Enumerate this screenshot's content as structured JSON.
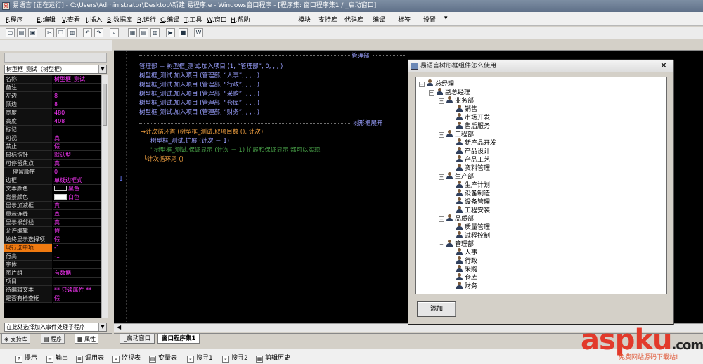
{
  "window": {
    "title": "易语言 [正在运行] - C:\\Users\\Administrator\\Desktop\\新建 易程序.e - Windows窗口程序 - [程序集: 窗口程序集1 / _启动窗口]"
  },
  "menu": {
    "items": [
      {
        "key": "F",
        "label": "程序"
      },
      {
        "key": "E",
        "label": "编辑"
      },
      {
        "key": "V",
        "label": "查看"
      },
      {
        "key": "I",
        "label": "插入"
      },
      {
        "key": "B",
        "label": "数据库"
      },
      {
        "key": "R",
        "label": "运行"
      },
      {
        "key": "C",
        "label": "编译"
      },
      {
        "key": "T",
        "label": "工具"
      },
      {
        "key": "W",
        "label": "窗口"
      },
      {
        "key": "H",
        "label": "帮助"
      }
    ],
    "right_items": [
      "模块",
      "支持库",
      "代码库",
      "编译",
      "标签",
      "设置"
    ]
  },
  "left_panel": {
    "combo_value": "树型框_测试（树型框）",
    "properties": [
      {
        "name": "名称",
        "value": "树型框_测试"
      },
      {
        "name": "备注",
        "value": ""
      },
      {
        "name": "左边",
        "value": "8"
      },
      {
        "name": "顶边",
        "value": "8"
      },
      {
        "name": "宽度",
        "value": "480"
      },
      {
        "name": "高度",
        "value": "408"
      },
      {
        "name": "标记",
        "value": ""
      },
      {
        "name": "可视",
        "value": "真"
      },
      {
        "name": "禁止",
        "value": "假"
      },
      {
        "name": "鼠标指针",
        "value": "默认型"
      },
      {
        "name": "可停留焦点",
        "value": "真"
      },
      {
        "name": "停留顺序",
        "value": "0"
      },
      {
        "name": "边框",
        "value": "单线边框式"
      },
      {
        "name": "文本颜色",
        "value": "黑色"
      },
      {
        "name": "背景颜色",
        "value": "白色"
      },
      {
        "name": "显示加减框",
        "value": "真"
      },
      {
        "name": "显示连线",
        "value": "真"
      },
      {
        "name": "显示根部线",
        "value": "真"
      },
      {
        "name": "允许编辑",
        "value": "假"
      },
      {
        "name": "始终显示选择项",
        "value": "假"
      },
      {
        "name": "现行选中项",
        "value": "-1"
      },
      {
        "name": "行高",
        "value": "-1"
      },
      {
        "name": "字体",
        "value": ""
      },
      {
        "name": "图片组",
        "value": "有数据"
      },
      {
        "name": "项目",
        "value": ""
      },
      {
        "name": "待编辑文本",
        "value": "** 只读属性 **"
      },
      {
        "name": "是否有检查框",
        "value": "假"
      }
    ],
    "event_combo": "在此处选择加入事件处理子程序",
    "tabs": [
      "支持库",
      "程序",
      "属性"
    ]
  },
  "code": {
    "header_label": "管理部",
    "lines": [
      "管理部 ＝ 树型框_测试.加入项目 (1, “管理部”, 0, , , )",
      "树型框_测试.加入项目 (管理部, “人事”, , , , )",
      "树型框_测试.加入项目 (管理部, “行政”, , , , )",
      "树型框_测试.加入项目 (管理部, “采购”, , , , )",
      "树型框_测试.加入项目 (管理部, “仓库”, , , , )",
      "树型框_测试.加入项目 (管理部, “财务”, , , , )"
    ],
    "section2_label": "树形框展开",
    "loop_head": "计次循环首 (树型框_测试.取项目数 (), 计次)",
    "loop_body": "树型框_测试.扩展 (计次 － 1)",
    "loop_comment": "' 树型框_测试.保证显示 (计次 － 1)   扩展和保证显示 都可以实现",
    "loop_tail": "计次循环尾 ()"
  },
  "editor_tabs": [
    "_启动窗口",
    "窗口程序集1"
  ],
  "bottom_bar": [
    "提示",
    "输出",
    "调用表",
    "监视表",
    "变量表",
    "搜寻1",
    "搜寻2",
    "剪辑历史"
  ],
  "dialog": {
    "title": "易语言树形框组件怎么使用",
    "close": "✕",
    "button": "添加",
    "tree": [
      {
        "level": 0,
        "label": "总经理",
        "expander": "−"
      },
      {
        "level": 1,
        "label": "副总经理",
        "expander": "−"
      },
      {
        "level": 2,
        "label": "业务部",
        "expander": "−"
      },
      {
        "level": 3,
        "label": "销售"
      },
      {
        "level": 3,
        "label": "市场开发"
      },
      {
        "level": 3,
        "label": "售后服务"
      },
      {
        "level": 2,
        "label": "工程部",
        "expander": "−"
      },
      {
        "level": 3,
        "label": "新产品开发"
      },
      {
        "level": 3,
        "label": "产品设计"
      },
      {
        "level": 3,
        "label": "产品工艺"
      },
      {
        "level": 3,
        "label": "资料管理"
      },
      {
        "level": 2,
        "label": "生产部",
        "expander": "−"
      },
      {
        "level": 3,
        "label": "生产计划"
      },
      {
        "level": 3,
        "label": "设备制造"
      },
      {
        "level": 3,
        "label": "设备管理"
      },
      {
        "level": 3,
        "label": "工程安装"
      },
      {
        "level": 2,
        "label": "品质部",
        "expander": "−"
      },
      {
        "level": 3,
        "label": "质量管理"
      },
      {
        "level": 3,
        "label": "过程控制"
      },
      {
        "level": 2,
        "label": "管理部",
        "expander": "−"
      },
      {
        "level": 3,
        "label": "人事"
      },
      {
        "level": 3,
        "label": "行政"
      },
      {
        "level": 3,
        "label": "采购"
      },
      {
        "level": 3,
        "label": "仓库"
      },
      {
        "level": 3,
        "label": "财务"
      }
    ]
  },
  "watermark": {
    "logo_asp": "asp",
    "logo_ku": "ku",
    "logo_dot": ".com",
    "sub": "免费网站源码下载站!"
  },
  "colors": {
    "editor_bg": "#000000",
    "code_normal": "#9aa0ff",
    "selected_property": "#f07a10",
    "property_value": "#ff37ff",
    "watermark": "#e23a2b"
  }
}
